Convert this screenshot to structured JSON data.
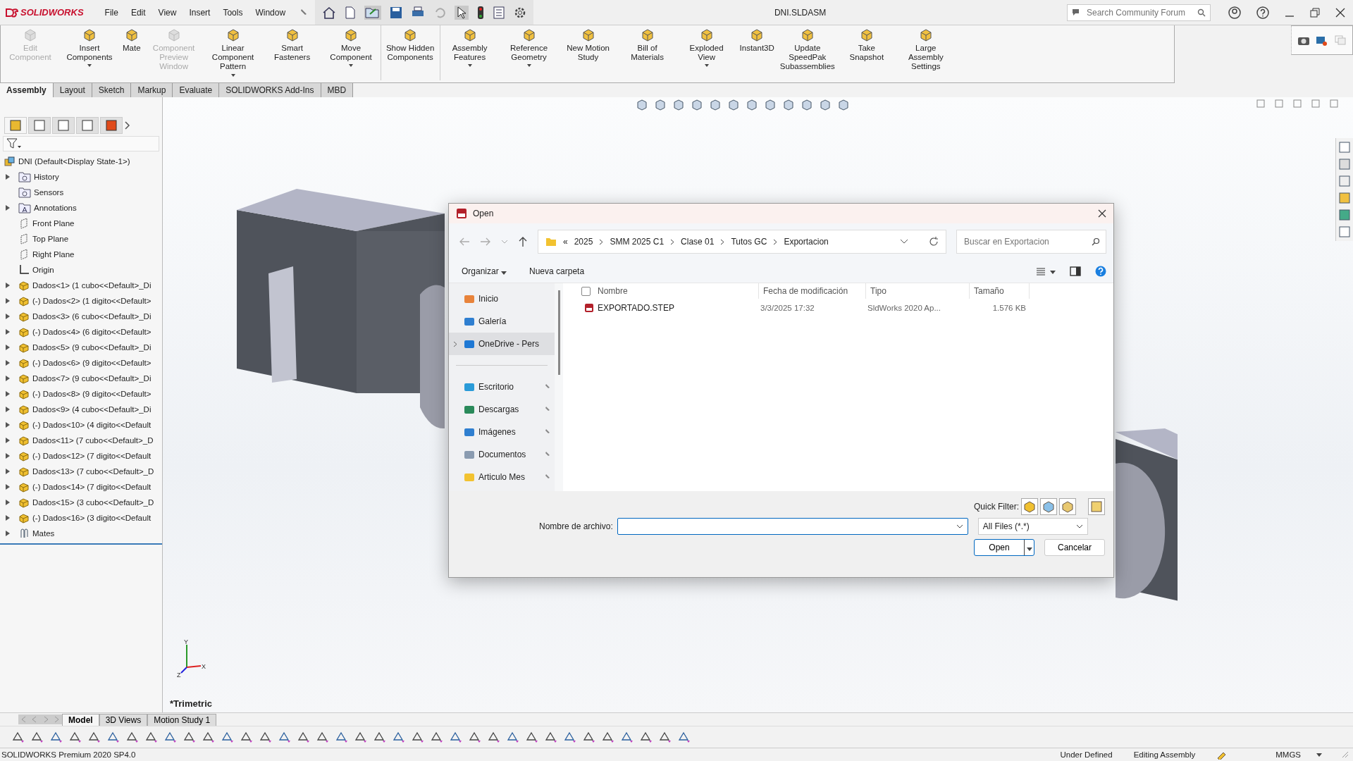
{
  "app": {
    "logo": "SOLIDWORKS",
    "menu": [
      "File",
      "Edit",
      "View",
      "Insert",
      "Tools",
      "Window"
    ],
    "title": "DNI.SLDASM",
    "search": {
      "placeholder": "Search Community Forum"
    }
  },
  "ribbon": [
    {
      "label": "Edit Component",
      "disabled": true,
      "dropdown": false
    },
    {
      "label": "Insert Components",
      "disabled": false,
      "dropdown": true
    },
    {
      "label": "Mate",
      "disabled": false,
      "dropdown": false
    },
    {
      "label": "Component Preview Window",
      "disabled": true,
      "dropdown": false
    },
    {
      "label": "Linear Component Pattern",
      "disabled": false,
      "dropdown": true
    },
    {
      "label": "Smart Fasteners",
      "disabled": false,
      "dropdown": false
    },
    {
      "label": "Move Component",
      "disabled": false,
      "dropdown": true
    },
    {
      "label": "Show Hidden Components",
      "disabled": false,
      "dropdown": false
    },
    {
      "label": "Assembly Features",
      "disabled": false,
      "dropdown": true
    },
    {
      "label": "Reference Geometry",
      "disabled": false,
      "dropdown": true
    },
    {
      "label": "New Motion Study",
      "disabled": false,
      "dropdown": false
    },
    {
      "label": "Bill of Materials",
      "disabled": false,
      "dropdown": false
    },
    {
      "label": "Exploded View",
      "disabled": false,
      "dropdown": true
    },
    {
      "label": "Instant3D",
      "disabled": false,
      "dropdown": false
    },
    {
      "label": "Update SpeedPak Subassemblies",
      "disabled": false,
      "dropdown": false
    },
    {
      "label": "Take Snapshot",
      "disabled": false,
      "dropdown": false
    },
    {
      "label": "Large Assembly Settings",
      "disabled": false,
      "dropdown": false
    }
  ],
  "command_tabs": [
    {
      "label": "Assembly",
      "selected": true
    },
    {
      "label": "Layout",
      "selected": false
    },
    {
      "label": "Sketch",
      "selected": false
    },
    {
      "label": "Markup",
      "selected": false
    },
    {
      "label": "Evaluate",
      "selected": false
    },
    {
      "label": "SOLIDWORKS Add-Ins",
      "selected": false
    },
    {
      "label": "MBD",
      "selected": false
    }
  ],
  "feature_tree": {
    "root": "DNI  (Default<Display State-1>)",
    "items": [
      {
        "label": "History",
        "kind": "history",
        "expandable": true
      },
      {
        "label": "Sensors",
        "kind": "sensors",
        "expandable": false
      },
      {
        "label": "Annotations",
        "kind": "annotations",
        "expandable": true
      },
      {
        "label": "Front Plane",
        "kind": "plane",
        "expandable": false
      },
      {
        "label": "Top Plane",
        "kind": "plane",
        "expandable": false
      },
      {
        "label": "Right Plane",
        "kind": "plane",
        "expandable": false
      },
      {
        "label": "Origin",
        "kind": "origin",
        "expandable": false
      },
      {
        "label": "Dados<1> (1 cubo<<Default>_Di",
        "kind": "part",
        "expandable": true
      },
      {
        "label": "(-) Dados<2> (1 digito<<Default>",
        "kind": "part",
        "expandable": true
      },
      {
        "label": "Dados<3> (6 cubo<<Default>_Di",
        "kind": "part",
        "expandable": true
      },
      {
        "label": "(-) Dados<4> (6 digito<<Default>",
        "kind": "part",
        "expandable": true
      },
      {
        "label": "Dados<5> (9 cubo<<Default>_Di",
        "kind": "part",
        "expandable": true
      },
      {
        "label": "(-) Dados<6> (9 digito<<Default>",
        "kind": "part",
        "expandable": true
      },
      {
        "label": "Dados<7> (9 cubo<<Default>_Di",
        "kind": "part",
        "expandable": true
      },
      {
        "label": "(-) Dados<8> (9 digito<<Default>",
        "kind": "part",
        "expandable": true
      },
      {
        "label": "Dados<9> (4 cubo<<Default>_Di",
        "kind": "part",
        "expandable": true
      },
      {
        "label": "(-) Dados<10> (4 digito<<Default",
        "kind": "part",
        "expandable": true
      },
      {
        "label": "Dados<11> (7 cubo<<Default>_D",
        "kind": "part",
        "expandable": true
      },
      {
        "label": "(-) Dados<12> (7 digito<<Default",
        "kind": "part",
        "expandable": true
      },
      {
        "label": "Dados<13> (7 cubo<<Default>_D",
        "kind": "part",
        "expandable": true
      },
      {
        "label": "(-) Dados<14> (7 digito<<Default",
        "kind": "part",
        "expandable": true
      },
      {
        "label": "Dados<15> (3 cubo<<Default>_D",
        "kind": "part",
        "expandable": true
      },
      {
        "label": "(-) Dados<16> (3 digito<<Default",
        "kind": "part",
        "expandable": true
      },
      {
        "label": "Mates",
        "kind": "mates",
        "expandable": true
      }
    ]
  },
  "viewport": {
    "view_label": "*Trimetric",
    "triad": [
      "Y",
      "X",
      "Z"
    ]
  },
  "dialog": {
    "title": "Open",
    "path_overflow": "«",
    "path": [
      "2025",
      "SMM 2025 C1",
      "Clase 01",
      "Tutos GC",
      "Exportacion"
    ],
    "search": {
      "placeholder": "Buscar en Exportacion"
    },
    "toolbar": {
      "organize": "Organizar",
      "new_folder": "Nueva carpeta"
    },
    "nav": [
      {
        "label": "Inicio",
        "kind": "home",
        "pinned": false,
        "selected": false,
        "expandable": false
      },
      {
        "label": "Galería",
        "kind": "gallery",
        "pinned": false,
        "selected": false,
        "expandable": false
      },
      {
        "label": "OneDrive - Pers",
        "kind": "cloud",
        "pinned": false,
        "selected": true,
        "expandable": true
      },
      {
        "label": "Escritorio",
        "kind": "desktop",
        "pinned": true,
        "selected": false,
        "expandable": false
      },
      {
        "label": "Descargas",
        "kind": "download",
        "pinned": true,
        "selected": false,
        "expandable": false
      },
      {
        "label": "Imágenes",
        "kind": "pictures",
        "pinned": true,
        "selected": false,
        "expandable": false
      },
      {
        "label": "Documentos",
        "kind": "documents",
        "pinned": true,
        "selected": false,
        "expandable": false
      },
      {
        "label": "Articulo Mes",
        "kind": "folder",
        "pinned": true,
        "selected": false,
        "expandable": false
      }
    ],
    "all_selected": false,
    "columns": [
      "Nombre",
      "Fecha de modificación",
      "Tipo",
      "Tamaño"
    ],
    "files": [
      {
        "name": "EXPORTADO.STEP",
        "modified": "3/3/2025 17:32",
        "type": "SldWorks 2020 Ap...",
        "size": "1.576 KB",
        "selected": false
      }
    ],
    "quick_filter": "Quick Filter:",
    "filename_label": "Nombre de archivo:",
    "filetype": "All Files (*.*)",
    "open": "Open",
    "cancel": "Cancelar"
  },
  "model_tabs": [
    {
      "label": "Model",
      "selected": true
    },
    {
      "label": "3D Views",
      "selected": false
    },
    {
      "label": "Motion Study 1",
      "selected": false
    }
  ],
  "status_bar": {
    "product": "SOLIDWORKS Premium 2020 SP4.0",
    "state": "Under Defined",
    "mode": "Editing Assembly",
    "units": "MMGS"
  }
}
